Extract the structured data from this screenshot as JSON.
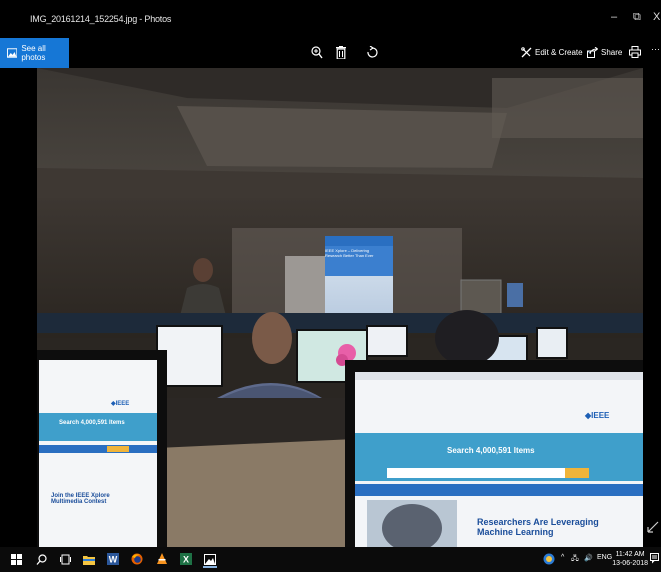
{
  "window": {
    "title": "IMG_20161214_152254.jpg - Photos",
    "minimize_glyph": "–",
    "maximize_glyph": "⧉",
    "close_glyph": "X"
  },
  "toolbar": {
    "see_all_label": "See all photos",
    "edit_create_label": "Edit & Create",
    "edit_chevron": "⌄",
    "share_label": "Share",
    "more_glyph": "···",
    "icons": [
      "image-icon",
      "zoom-icon",
      "delete-icon",
      "rotate-icon",
      "edit-create-icon",
      "share-icon",
      "print-icon",
      "more-icon"
    ]
  },
  "photo": {
    "slide_title": "IEEE Xplore – Delivering Research Better Than Ever",
    "search_banner": "Search 4,000,591 Items",
    "left_search_banner": "Search 4,000,591 Items",
    "research_text": "Researchers Are Leveraging Machine Learning",
    "left_promo_text": "Join the IEEE Xplore Multimedia Contest",
    "ieee_logo": "◆IEEE",
    "left_ieee_logo": "◆IEEE",
    "colors": {
      "ieee_blue": "#2a6fc1",
      "banner_teal": "#3f9fcb",
      "accent_orange": "#f0b43a"
    }
  },
  "taskbar": {
    "icons": [
      "windows-start-icon",
      "search-icon",
      "task-view-icon",
      "file-explorer-icon",
      "word-icon",
      "firefox-icon",
      "vlc-icon",
      "excel-icon",
      "photos-icon"
    ],
    "tray_chevron": "^",
    "tray_network": "🖧",
    "tray_volume": "🔊",
    "language": "ENG",
    "time": "11:42 AM",
    "date": "13-06-2018"
  },
  "accent_colors": {
    "see_all_bg": "#1677d6",
    "taskbar_bg": "#0b0b0b"
  }
}
